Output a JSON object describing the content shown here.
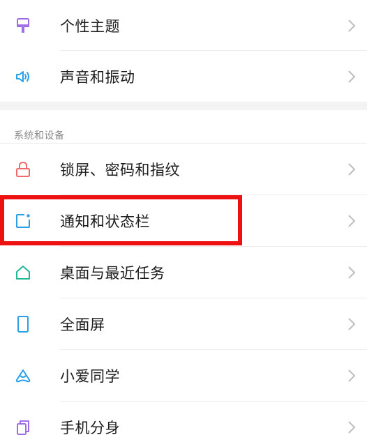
{
  "colors": {
    "purple": "#a06ce8",
    "blue": "#2aa0e8",
    "red": "#f06a6a",
    "teal": "#22b89a",
    "highlight": "#ee1111",
    "chevron": "#bdbdbd"
  },
  "group1": {
    "items": [
      {
        "label": "个性主题",
        "icon": "theme-brush-icon"
      },
      {
        "label": "声音和振动",
        "icon": "speaker-icon"
      }
    ]
  },
  "section2": {
    "header": "系统和设备",
    "items": [
      {
        "label": "锁屏、密码和指纹",
        "icon": "lock-icon"
      },
      {
        "label": "通知和状态栏",
        "icon": "notification-icon"
      },
      {
        "label": "桌面与最近任务",
        "icon": "home-icon"
      },
      {
        "label": "全面屏",
        "icon": "phone-screen-icon"
      },
      {
        "label": "小爱同学",
        "icon": "xiaoai-icon"
      },
      {
        "label": "手机分身",
        "icon": "dual-phone-icon"
      }
    ]
  }
}
